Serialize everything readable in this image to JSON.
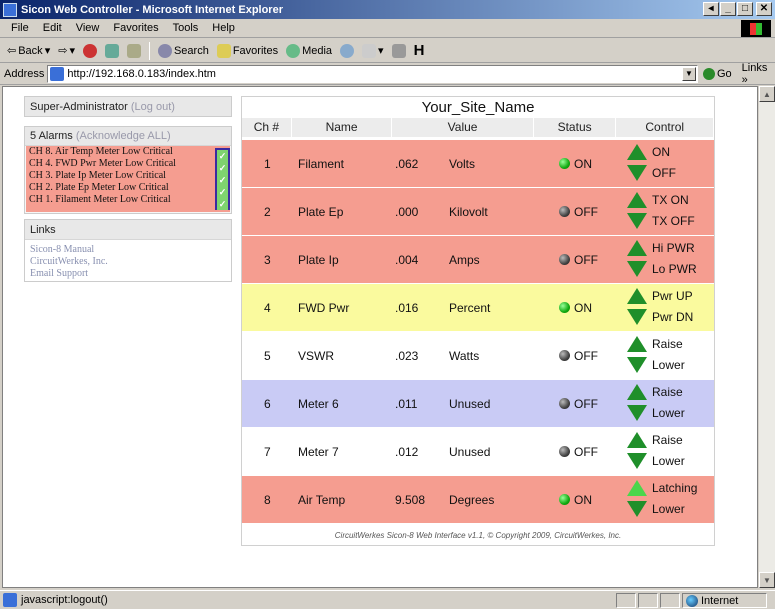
{
  "window": {
    "title": "Sicon Web Controller - Microsoft Internet Explorer"
  },
  "menubar": [
    "File",
    "Edit",
    "View",
    "Favorites",
    "Tools",
    "Help"
  ],
  "toolbar": {
    "back": "Back",
    "search": "Search",
    "favorites": "Favorites",
    "media": "Media",
    "h": "H"
  },
  "address": {
    "label": "Address",
    "url": "http://192.168.0.183/index.htm",
    "go": "Go",
    "links": "Links"
  },
  "status": {
    "text": "javascript:logout()",
    "zone": "Internet"
  },
  "user": {
    "name": "Super-Administrator",
    "logout": "(Log out)"
  },
  "alarms": {
    "heading": "5 Alarms",
    "ack": "(Acknowledge ALL)",
    "items": [
      "CH 8. Air Temp Meter Low Critical",
      "CH 4. FWD Pwr Meter Low Critical",
      "CH 3. Plate Ip Meter Low Critical",
      "CH 2. Plate Ep Meter Low Critical",
      "CH 1. Filament Meter Low Critical"
    ]
  },
  "links": {
    "heading": "Links",
    "items": [
      "Sicon-8 Manual",
      "CircuitWerkes, Inc.",
      "Email Support"
    ]
  },
  "site": {
    "name": "Your_Site_Name"
  },
  "table": {
    "headers": {
      "ch": "Ch #",
      "name": "Name",
      "value": "Value",
      "status": "Status",
      "control": "Control"
    },
    "rows": [
      {
        "ch": "1",
        "name": "Filament",
        "value": ".062",
        "unit": "Volts",
        "status": "ON",
        "on": true,
        "up": "ON",
        "down": "OFF",
        "color": "#f59d90"
      },
      {
        "ch": "2",
        "name": "Plate Ep",
        "value": ".000",
        "unit": "Kilovolt",
        "status": "OFF",
        "on": false,
        "up": "TX ON",
        "down": "TX OFF",
        "color": "#f59d90"
      },
      {
        "ch": "3",
        "name": "Plate Ip",
        "value": ".004",
        "unit": "Amps",
        "status": "OFF",
        "on": false,
        "up": "Hi PWR",
        "down": "Lo PWR",
        "color": "#f59d90"
      },
      {
        "ch": "4",
        "name": "FWD Pwr",
        "value": ".016",
        "unit": "Percent",
        "status": "ON",
        "on": true,
        "up": "Pwr UP",
        "down": "Pwr DN",
        "color": "#fafa9e"
      },
      {
        "ch": "5",
        "name": "VSWR",
        "value": ".023",
        "unit": "Watts",
        "status": "OFF",
        "on": false,
        "up": "Raise",
        "down": "Lower",
        "color": "#ffffff"
      },
      {
        "ch": "6",
        "name": "Meter 6",
        "value": ".011",
        "unit": "Unused",
        "status": "OFF",
        "on": false,
        "up": "Raise",
        "down": "Lower",
        "color": "#c9cbf5"
      },
      {
        "ch": "7",
        "name": "Meter 7",
        "value": ".012",
        "unit": "Unused",
        "status": "OFF",
        "on": false,
        "up": "Raise",
        "down": "Lower",
        "color": "#ffffff"
      },
      {
        "ch": "8",
        "name": "Air Temp",
        "value": "9.508",
        "unit": "Degrees",
        "status": "ON",
        "on": true,
        "up": "Latching",
        "down": "Lower",
        "color": "#f59d90"
      }
    ]
  },
  "footer": "CircuitWerkes Sicon-8 Web Interface v1.1, © Copyright 2009, CircuitWerkes, Inc."
}
